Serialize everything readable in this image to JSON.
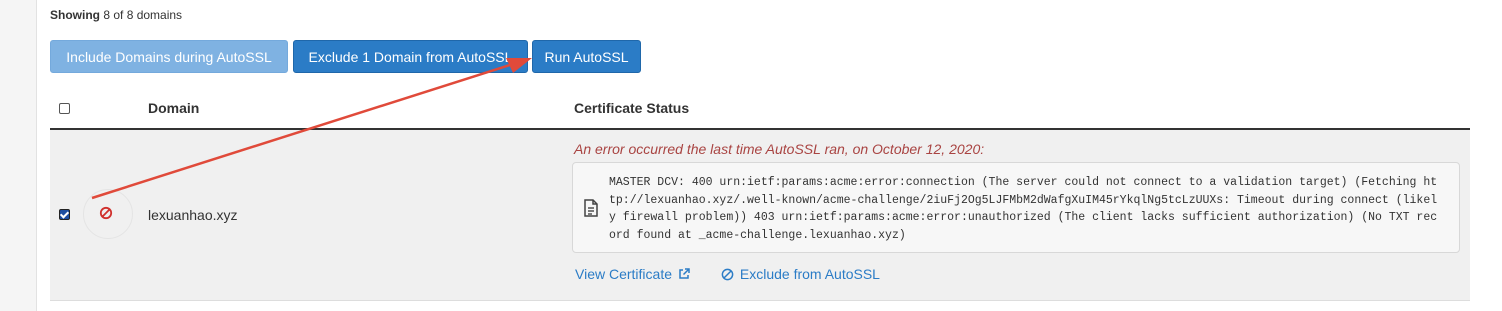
{
  "showing": {
    "prefix": "Showing",
    "text": "8 of 8 domains"
  },
  "toolbar": {
    "include_label": "Include Domains during AutoSSL",
    "exclude_label": "Exclude 1 Domain from AutoSSL",
    "run_label": "Run AutoSSL"
  },
  "table": {
    "headers": {
      "domain": "Domain",
      "status": "Certificate Status"
    },
    "rows": [
      {
        "checked": true,
        "status_icon": "ban-icon",
        "domain": "lexuanhao.xyz",
        "error_title": "An error occurred the last time AutoSSL ran, on October 12, 2020:",
        "error_message": "MASTER DCV: 400 urn:ietf:params:acme:error:connection (The server could not connect to a validation target) (Fetching http://lexuanhao.xyz/.well-known/acme-challenge/2iuFj2Og5LJFMbM2dWafgXuIM45rYkqlNg5tcLzUUXs: Timeout during connect (likely firewall problem)) 403 urn:ietf:params:acme:error:unauthorized (The client lacks sufficient authorization) (No TXT record found at _acme-challenge.lexuanhao.xyz)",
        "view_certificate_label": "View Certificate",
        "exclude_label": "Exclude from AutoSSL"
      }
    ]
  },
  "colors": {
    "primary": "#2b7cc6",
    "error": "#a94442",
    "annotation_arrow": "#e04a3a"
  }
}
